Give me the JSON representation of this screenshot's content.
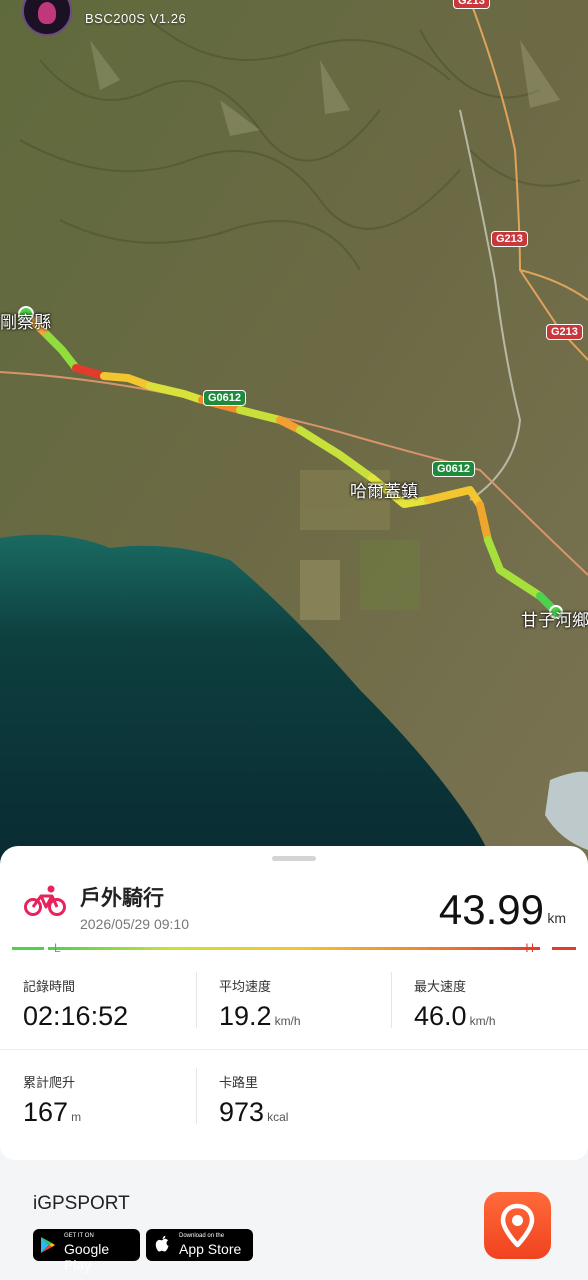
{
  "header": {
    "device_label": "BSC200S V1.26"
  },
  "map": {
    "road_badges": {
      "g213_a": "G213",
      "g213_b": "G213",
      "g0612_a": "G0612",
      "g0612_b": "G0612"
    },
    "places": {
      "start_town": "剛察縣",
      "mid_town": "哈爾蓋鎮",
      "end_town": "甘子河鄉"
    }
  },
  "activity": {
    "title": "戶外騎行",
    "datetime": "2026/05/29 09:10",
    "distance": "43.99",
    "distance_unit": "km",
    "scale_low": "L",
    "scale_high": "H"
  },
  "stats": {
    "record_time": {
      "label": "記錄時間",
      "value": "02:16:52"
    },
    "avg_speed": {
      "label": "平均速度",
      "value": "19.2",
      "unit": "km/h"
    },
    "max_speed": {
      "label": "最大速度",
      "value": "46.0",
      "unit": "km/h"
    },
    "elevation_gain": {
      "label": "累計爬升",
      "value": "167",
      "unit": "m"
    },
    "calories": {
      "label": "卡路里",
      "value": "973",
      "unit": "kcal"
    }
  },
  "footer": {
    "brand": "iGPSPORT",
    "google_play": {
      "small": "GET IT ON",
      "big": "Google Play"
    },
    "app_store": {
      "small": "Download on the",
      "big": "App Store"
    }
  },
  "colors": {
    "accent": "#f04a22",
    "route_low": "#4cd24c",
    "route_high": "#e23b2c"
  }
}
